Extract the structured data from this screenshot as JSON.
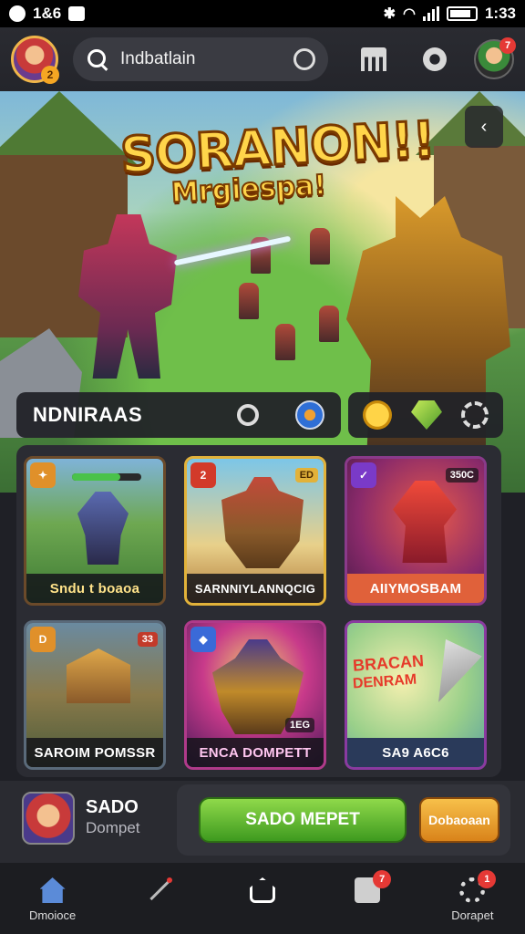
{
  "status_bar": {
    "left_text": "1&6",
    "time": "1:33"
  },
  "header": {
    "avatar_level": "2",
    "search_text": "Indbatlain",
    "profile_badge": "7"
  },
  "hero": {
    "title_line1": "SORANON!!",
    "title_line2": "Mrgiespa!",
    "side_button_icon": "chevron-icon"
  },
  "filter": {
    "label": "NDNIRAAS"
  },
  "cards": [
    {
      "caption": "Sndu t boaoa",
      "badge": "",
      "tag": ""
    },
    {
      "caption": "SARNNIYLANNQCIG",
      "badge": "2",
      "tag": "ED"
    },
    {
      "caption": "AIIYMOSBAM",
      "badge": "",
      "tag": "350C"
    },
    {
      "caption": "SAROIM POMSSR",
      "badge": "D",
      "tag": "33"
    },
    {
      "caption": "ENCA DOMPETT",
      "badge": "",
      "tag": "1EG"
    },
    {
      "caption": "SA9 A6C6",
      "promo_line1": "BRACAN",
      "promo_line2": "DENRAM",
      "badge": "",
      "tag": ""
    }
  ],
  "bottom": {
    "item_name": "SADO",
    "item_sub": "Dompet",
    "primary_button": "SADO MEPET",
    "secondary_button": "Dobaoaan"
  },
  "nav": {
    "items": [
      {
        "label": "Dmoioce",
        "icon": "home-icon",
        "badge": ""
      },
      {
        "label": "",
        "icon": "wand-icon",
        "badge": ""
      },
      {
        "label": "",
        "icon": "home-outline-icon",
        "badge": ""
      },
      {
        "label": "",
        "icon": "chat-icon",
        "badge": "7"
      },
      {
        "label": "Dorapet",
        "icon": "gear-icon",
        "badge": "1"
      }
    ]
  },
  "colors": {
    "accent_green": "#5bbd2e",
    "accent_orange": "#f0a030",
    "title_gold": "#ffd54a",
    "badge_red": "#e53935"
  }
}
